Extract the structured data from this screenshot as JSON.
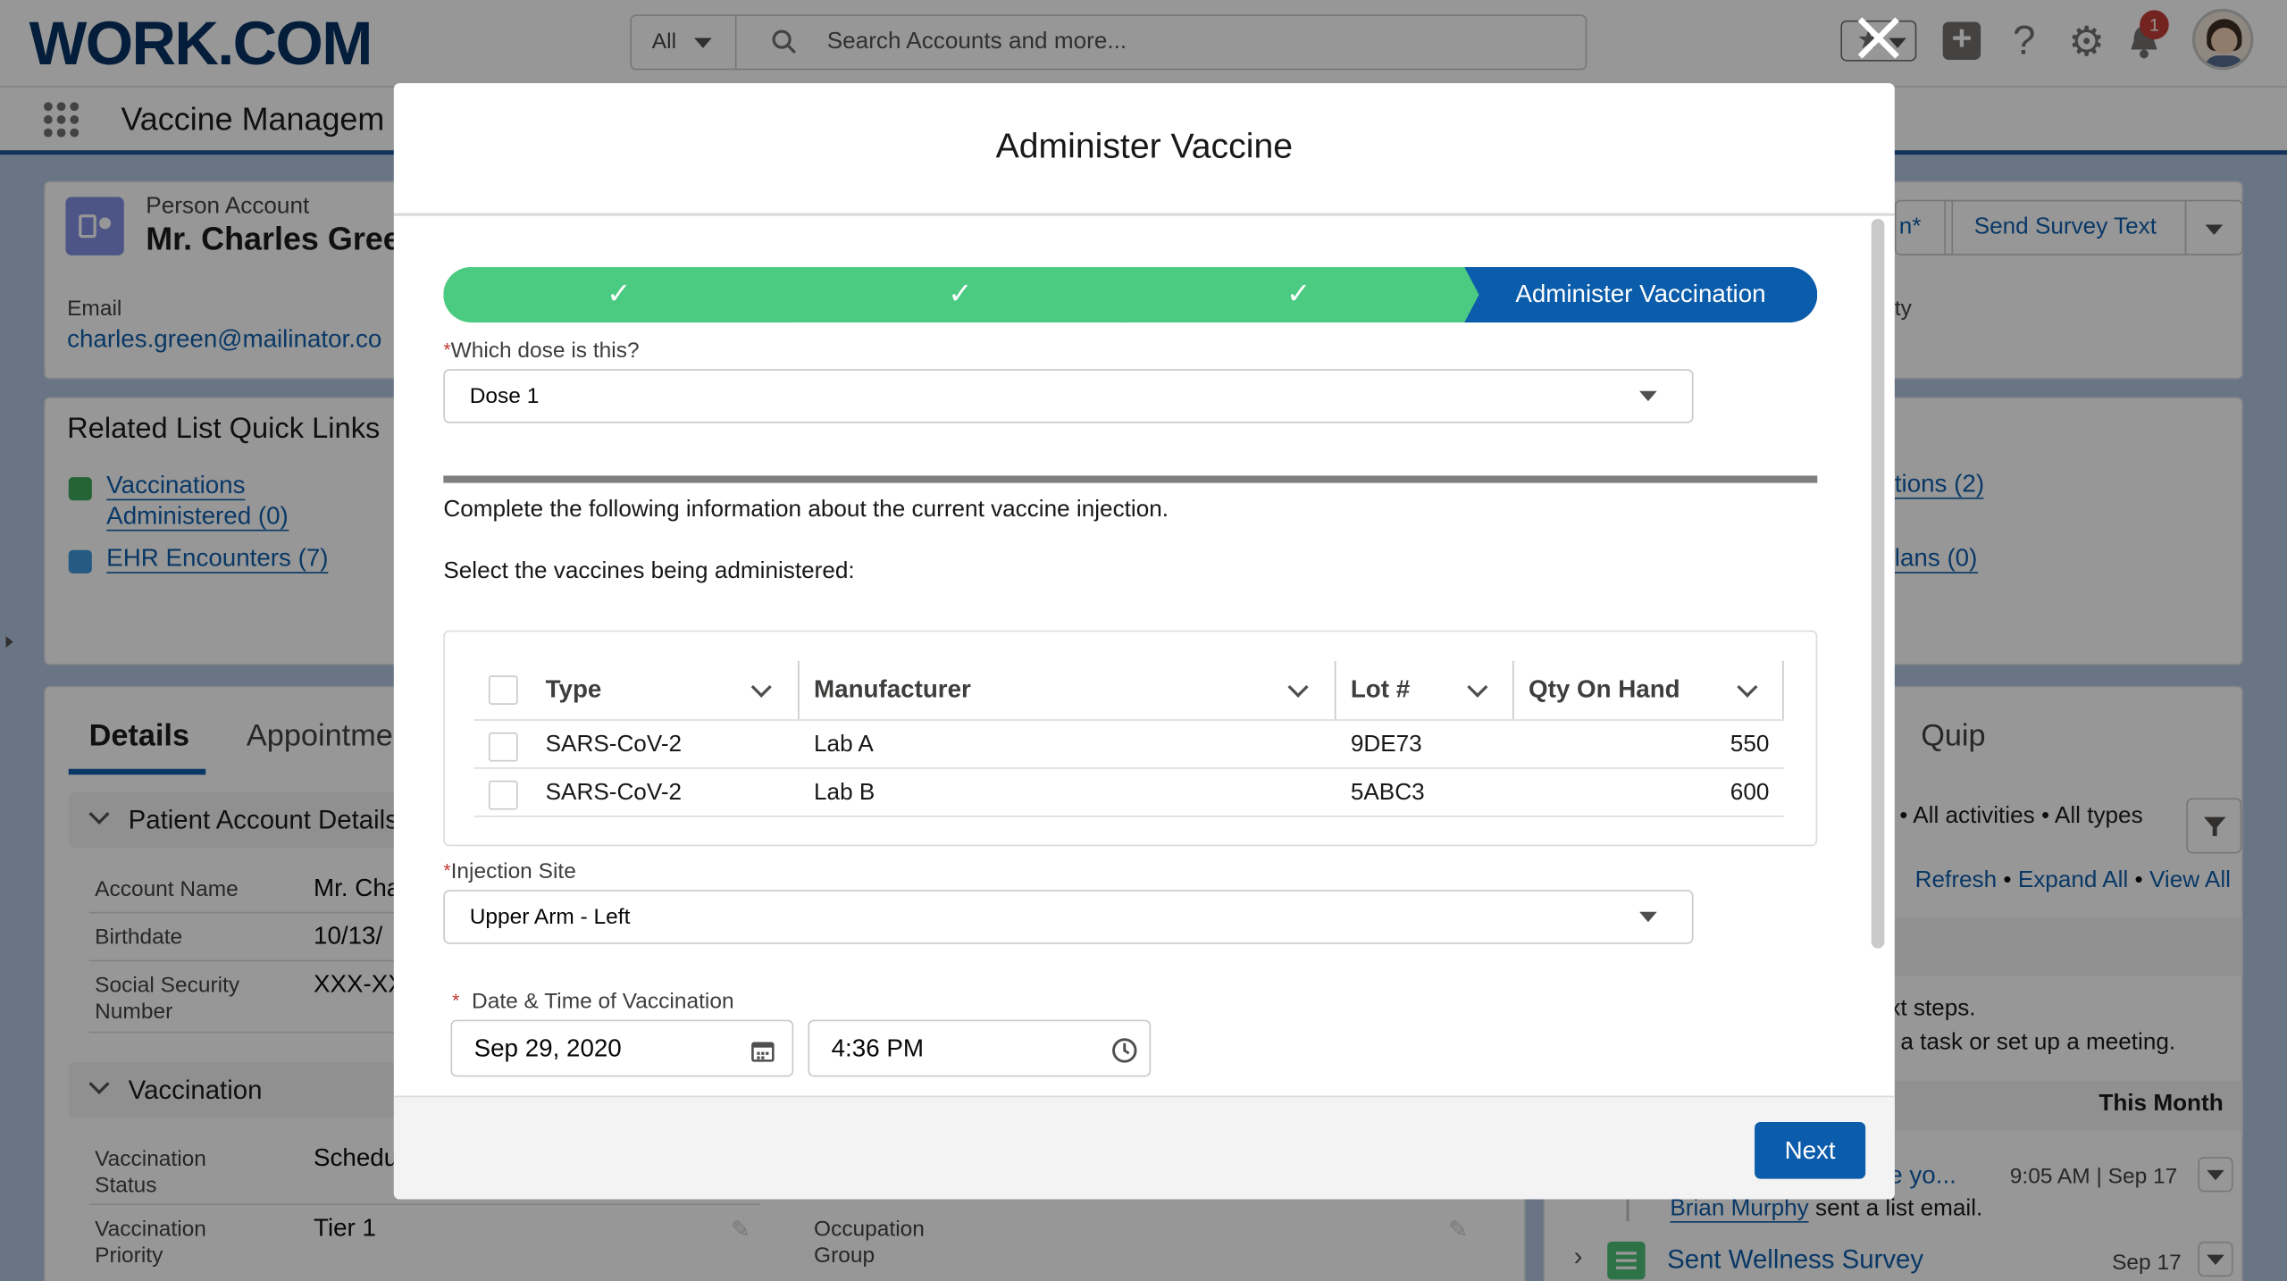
{
  "header": {
    "logo": "WORK.COM",
    "search_scope": "All",
    "search_placeholder": "Search Accounts and more...",
    "notification_count": "1"
  },
  "nav": {
    "app_name": "Vaccine Managem"
  },
  "record": {
    "type": "Person Account",
    "name": "Mr. Charles Gree",
    "email_label": "Email",
    "email": "charles.green@mailinator.co",
    "action_fragment": "n*",
    "send_survey": "Send Survey Text",
    "right_label_fragment": "ty"
  },
  "quick_links": {
    "title": "Related List Quick Links",
    "vacc_line1": "Vaccinations",
    "vacc_line2": "Administered (0)",
    "ehr": "EHR Encounters (7)",
    "right1": "tions (2)",
    "right2": "lans (0)"
  },
  "tabs": {
    "details": "Details",
    "appointments": "Appointme",
    "quip": "Quip"
  },
  "details": {
    "section1": "Patient Account Details",
    "account_name_label": "Account Name",
    "account_name_value": "Mr. Cha",
    "birthdate_label": "Birthdate",
    "birthdate_value": "10/13/",
    "ssn_label1": "Social Security",
    "ssn_label2": "Number",
    "ssn_value": "XXX-XX",
    "section2": "Vaccination",
    "vstatus_label1": "Vaccination",
    "vstatus_label2": "Status",
    "vstatus_value": "Schedu",
    "vpriority_label1": "Vaccination",
    "vpriority_label2": "Priority",
    "vpriority_value": "Tier 1",
    "occupation_label1": "Occupation",
    "occupation_label2": "Group"
  },
  "activity": {
    "filter_text": "e • All activities • All types",
    "refresh": "Refresh",
    "expand_all": "Expand All",
    "view_all": "View All",
    "next_steps": "xt steps.",
    "next_steps2": "l a task or set up a meeting.",
    "this_month": "This Month",
    "item1_title": "e yo...",
    "item1_time": "9:05 AM | Sep 17",
    "item1_person": "Brian Murphy",
    "item1_action": "sent a list email.",
    "item2_title": "Sent Wellness Survey",
    "item2_date": "Sep 17"
  },
  "modal": {
    "title": "Administer Vaccine",
    "current_step": "Administer Vaccination",
    "dose_label": "Which dose is this?",
    "dose_value": "Dose 1",
    "info_text": "Complete the following information about the current vaccine injection.",
    "select_text": "Select the vaccines being administered:",
    "columns": [
      "Type",
      "Manufacturer",
      "Lot #",
      "Qty On Hand"
    ],
    "rows": [
      {
        "type": "SARS-CoV-2",
        "manufacturer": "Lab A",
        "lot": "9DE73",
        "qty": "550"
      },
      {
        "type": "SARS-CoV-2",
        "manufacturer": "Lab B",
        "lot": "5ABC3",
        "qty": "600"
      }
    ],
    "site_label": "Injection Site",
    "site_value": "Upper Arm - Left",
    "datetime_label": "Date & Time of Vaccination",
    "date_value": "Sep 29, 2020",
    "time_value": "4:36 PM",
    "next_button": "Next"
  }
}
